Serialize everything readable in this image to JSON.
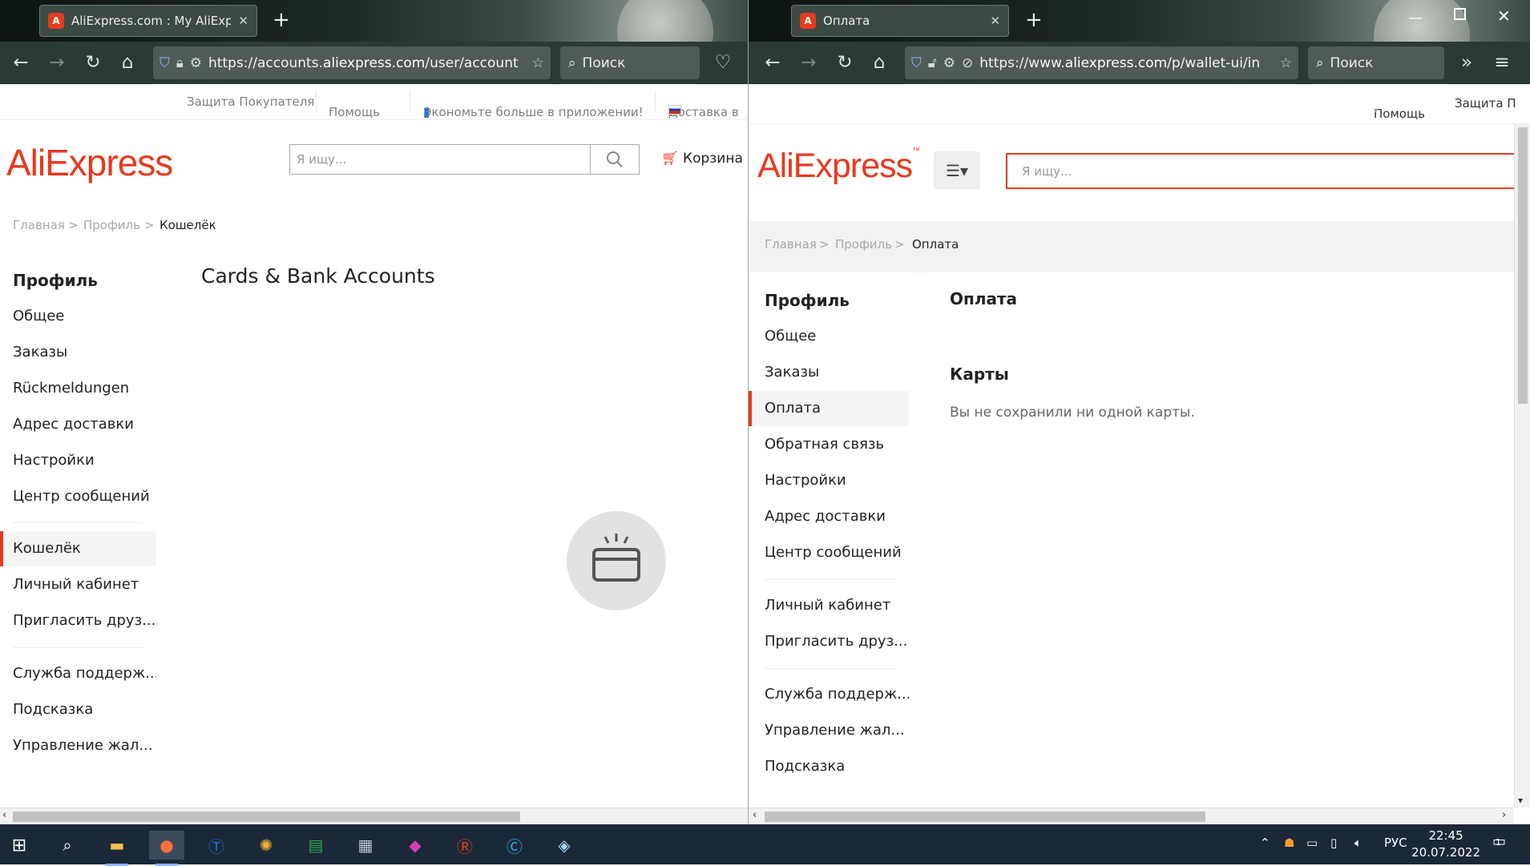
{
  "left": {
    "tab": {
      "title": "AliExpress.com : My AliExpress",
      "close": "✕"
    },
    "url": {
      "prefix": "https://accounts.",
      "domain": "aliexpress.com",
      "path": "/user/account"
    },
    "search_placeholder": "Поиск",
    "topbar": {
      "buyer_protection": "Защита Покупателя",
      "help": "Помощь",
      "app": "Экономьте больше в приложении!",
      "delivery": "Доставка в"
    },
    "logo": "AliExpress",
    "search_input_placeholder": "Я ищу...",
    "cart": "Корзина",
    "breadcrumbs": [
      "Главная",
      ">",
      "Профиль",
      ">",
      "Кошелёк"
    ],
    "sidebar": {
      "title": "Профиль",
      "items": [
        "Общее",
        "Заказы",
        "Rückmeldungen",
        "Адрес доставки",
        "Настройки",
        "Центр сообщений",
        "Кошелёк",
        "Личный кабинет",
        "Пригласить друз...",
        "Служба поддерж...",
        "Подсказка",
        "Управление жал..."
      ],
      "active_index": 6
    },
    "main_title": "Cards & Bank Accounts"
  },
  "right": {
    "tab": {
      "title": "Оплата",
      "close": "✕"
    },
    "url": {
      "prefix": "https://www.",
      "domain": "aliexpress.com",
      "path": "/p/wallet-ui/in"
    },
    "search_placeholder": "Поиск",
    "topbar": {
      "help": "Помощь",
      "protection": "Защита П"
    },
    "logo": "AliExpress",
    "logo_tm": "™",
    "search_input_placeholder": "Я ищу...",
    "breadcrumbs": [
      "Главная",
      ">",
      "Профиль",
      ">",
      "Оплата"
    ],
    "sidebar": {
      "title": "Профиль",
      "items": [
        "Общее",
        "Заказы",
        "Оплата",
        "Обратная связь",
        "Настройки",
        "Адрес доставки",
        "Центр сообщений",
        "Личный кабинет",
        "Пригласить друз...",
        "Служба поддерж...",
        "Управление жал...",
        "Подсказка"
      ],
      "active_index": 2
    },
    "page_title": "Оплата",
    "cards": {
      "title": "Карты",
      "empty": "Вы не сохранили ни одной карты."
    }
  },
  "taskbar": {
    "lang": "РУС",
    "time": "22:45",
    "date": "20.07.2022",
    "notifications": "1"
  },
  "colors": {
    "brand": "#e8391e",
    "chrome": "#2c3a36",
    "taskbar": "#1b2838"
  }
}
